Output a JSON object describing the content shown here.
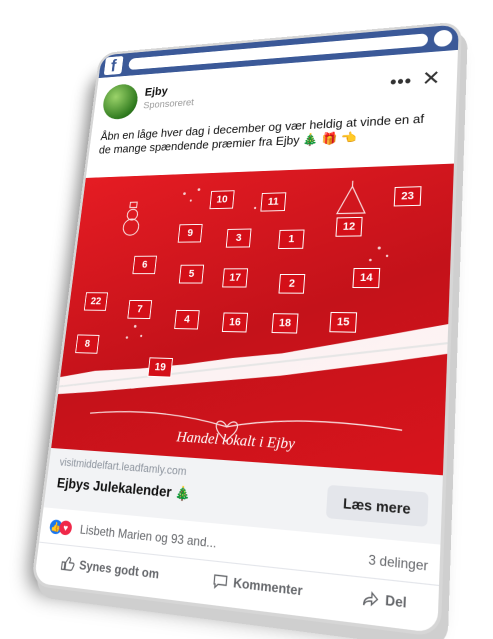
{
  "browser": {
    "logo": "f",
    "icon": "facebook-icon"
  },
  "post": {
    "page_name": "Ejby",
    "sponsored": "Sponsoreret",
    "more": "•••",
    "close": "✕",
    "caption": "Åbn en låge hver dag i december og vær heldig at vinde en af de mange spændende præmier fra Ejby",
    "emoji_tree": "🎄",
    "emoji_gift": "🎁",
    "emoji_hand": "👈"
  },
  "banner": {
    "doors": [
      "10",
      "11",
      "23",
      "9",
      "3",
      "1",
      "12",
      "6",
      "5",
      "17",
      "2",
      "14",
      "22",
      "7",
      "4",
      "16",
      "18",
      "15",
      "8",
      "19"
    ],
    "footer_text": "Handel lokalt i Ejby"
  },
  "link": {
    "domain": "visitmiddelfart.leadfamly.com",
    "title": "Ejbys Julekalender",
    "title_emoji": "🎄",
    "button": "Læs mere"
  },
  "reactions": {
    "names": "Lisbeth Marien og 93 and...",
    "shares": "3 delinger",
    "like_icon": "thumbs-up-icon",
    "love_icon": "heart-icon"
  },
  "actions": {
    "like": "Synes godt om",
    "comment": "Kommenter",
    "share": "Del"
  },
  "colors": {
    "facebook_blue": "#3b5998",
    "banner_red": "#e51c23"
  }
}
